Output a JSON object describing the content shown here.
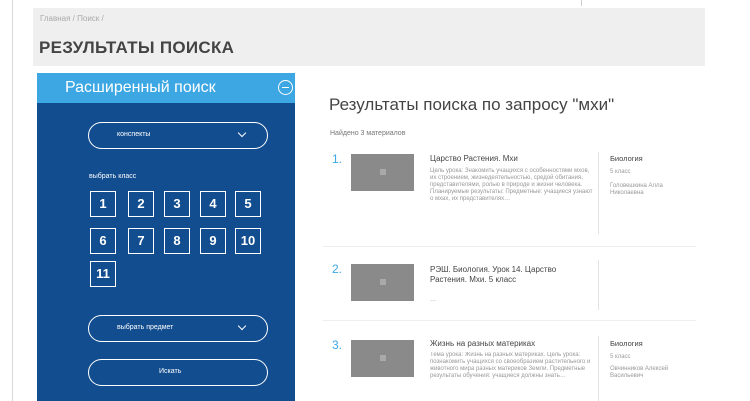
{
  "breadcrumb": "Главная / Поиск /",
  "page_title": "РЕЗУЛЬТАТЫ ПОИСКА",
  "sidebar": {
    "title": "Расширенный поиск",
    "type_select": "конспекты",
    "class_label": "выбрать класс",
    "grades": [
      "1",
      "2",
      "3",
      "4",
      "5",
      "6",
      "7",
      "8",
      "9",
      "10",
      "11"
    ],
    "subject_select": "выбрать предмет",
    "search_button": "Искать"
  },
  "results": {
    "heading": "Результаты поиска по запросу \"мхи\"",
    "found": "Найдено 3 материалов",
    "items": [
      {
        "num": "1.",
        "title": "Царство Растения. Мхи",
        "desc": "Цель урока: Знакомить учащихся с особенностями мхов, их строением, жизнедеятельностью, средой обитания, представителями, ролью в природе и жизни человека. Планируемые результаты: Предметные: учащиеся узнают о мхах, их представителях…",
        "subject": "Биология",
        "grade": "5 класс",
        "author": "Головешкина Алла Николаевна"
      },
      {
        "num": "2.",
        "title": "РЭШ. Биология. Урок 14. Царство Растения. Мхи. 5 класс",
        "desc": "…",
        "subject": "",
        "grade": "",
        "author": ""
      },
      {
        "num": "3.",
        "title": "Жизнь на разных материках",
        "desc": "Тема урока: Жизнь на разных материках. Цель урока: познакомить учащихся со своеобразием растительного и животного мира разных материков Земли. Предметные результаты обучения: учащиеся должны знать…",
        "subject": "Биология",
        "grade": "5 класс",
        "author": "Овчинников Алексей Васильевич"
      }
    ]
  }
}
